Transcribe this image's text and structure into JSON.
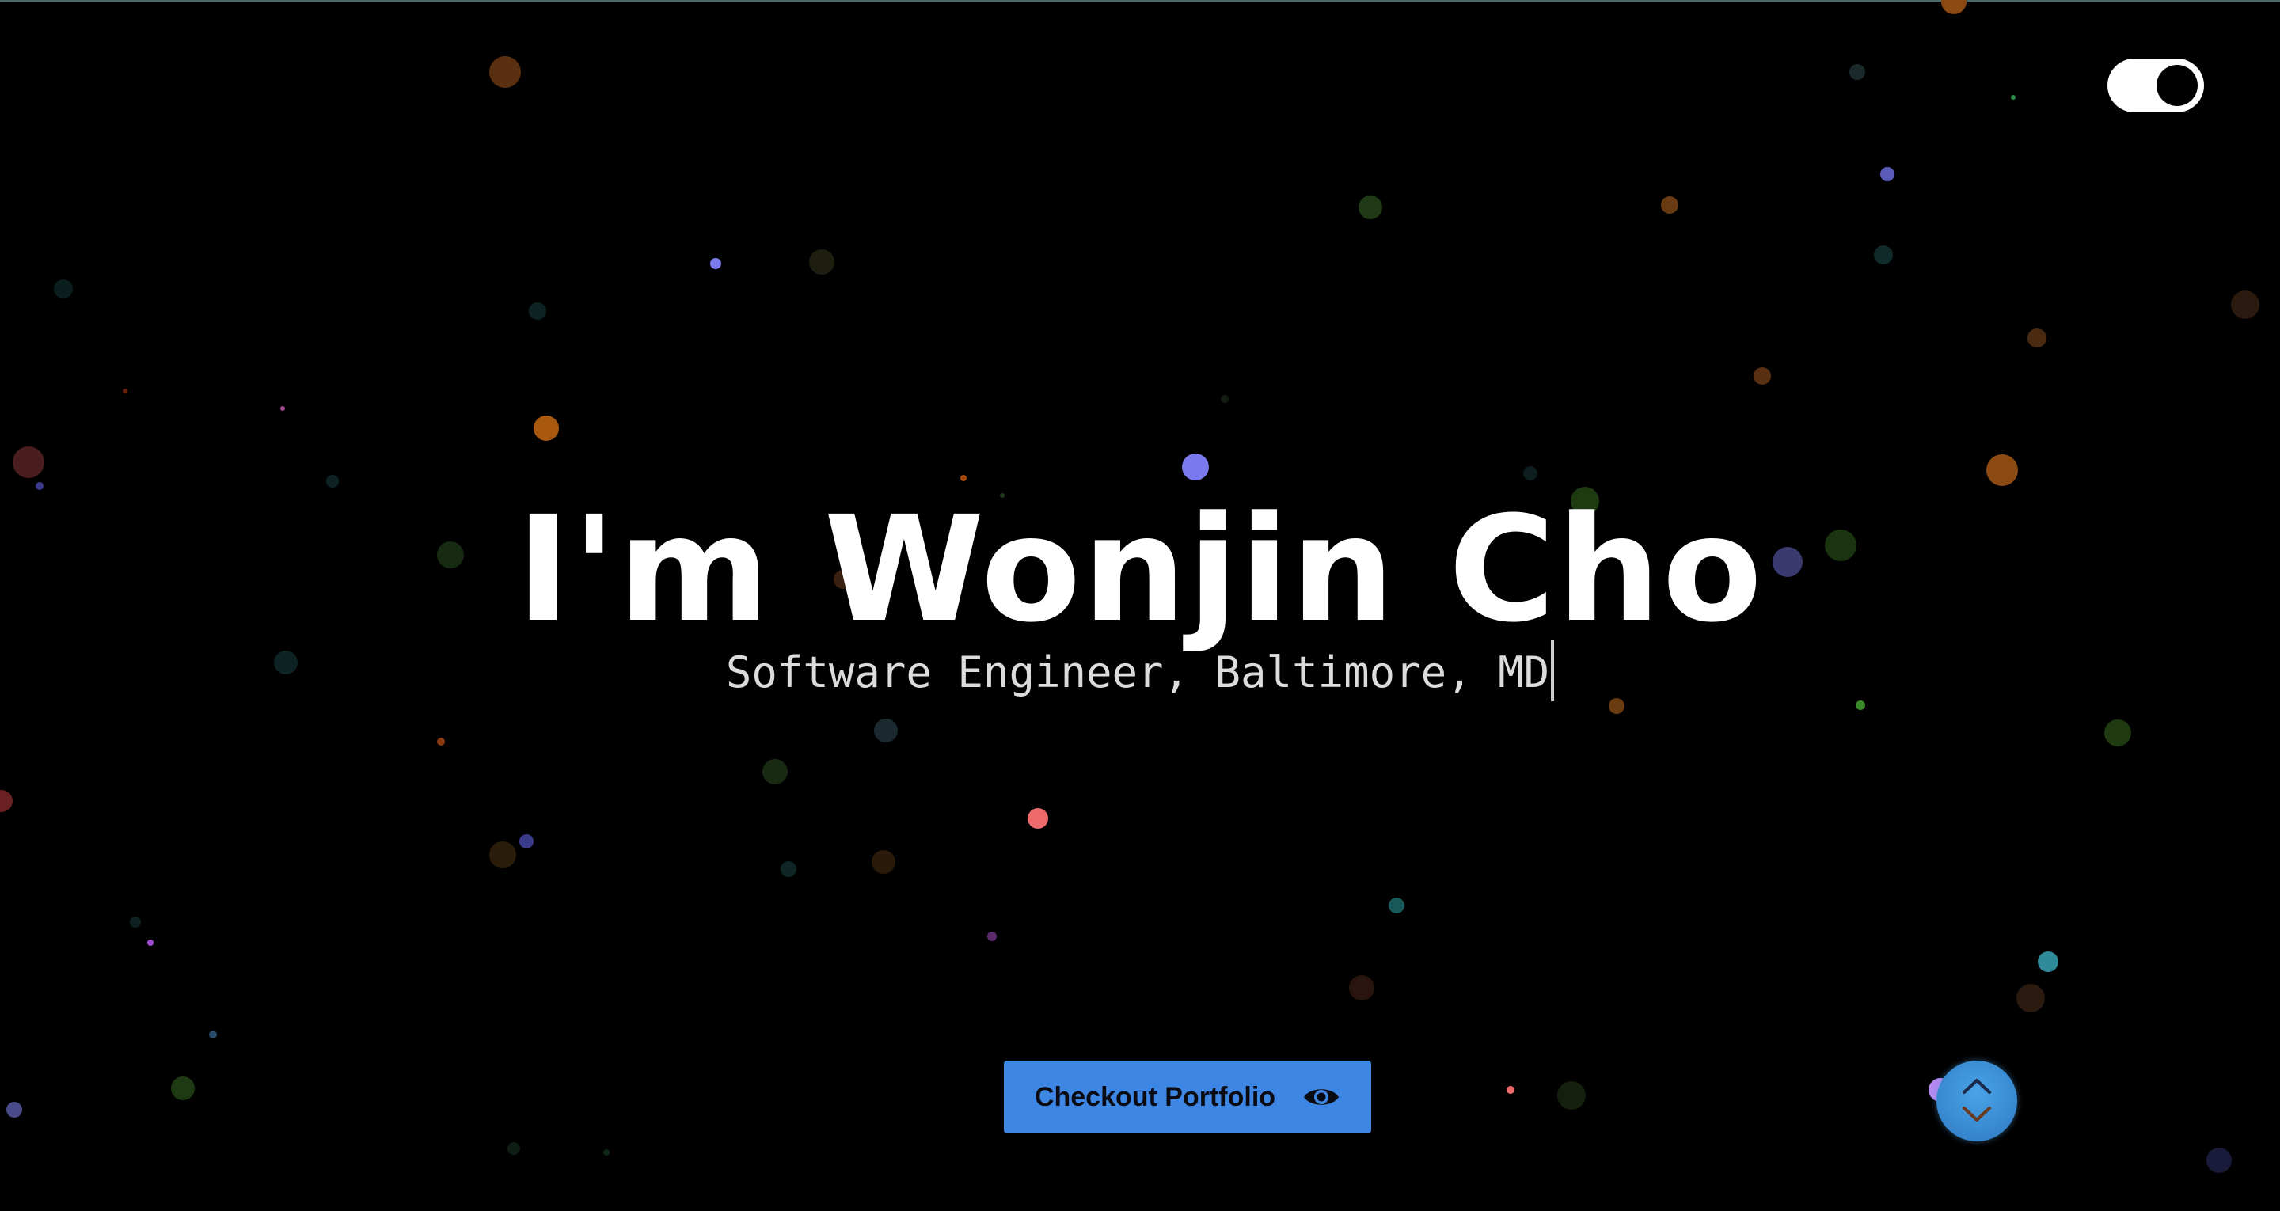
{
  "hero": {
    "title": "I'm Wonjin Cho",
    "subtitle": "Software Engineer, Baltimore, MD"
  },
  "cta": {
    "label": "Checkout Portfolio",
    "icon": "eye-icon"
  },
  "toggle": {
    "state": "on",
    "icon": "theme-toggle"
  },
  "scroll_button": {
    "icons": [
      "chevron-up-icon",
      "chevron-down-icon"
    ]
  },
  "colors": {
    "background": "#000000",
    "title": "#ffffff",
    "subtitle": "#dcdcdc",
    "cta_background": "#3d86e4",
    "scroll_button": "#3a8fd8"
  }
}
